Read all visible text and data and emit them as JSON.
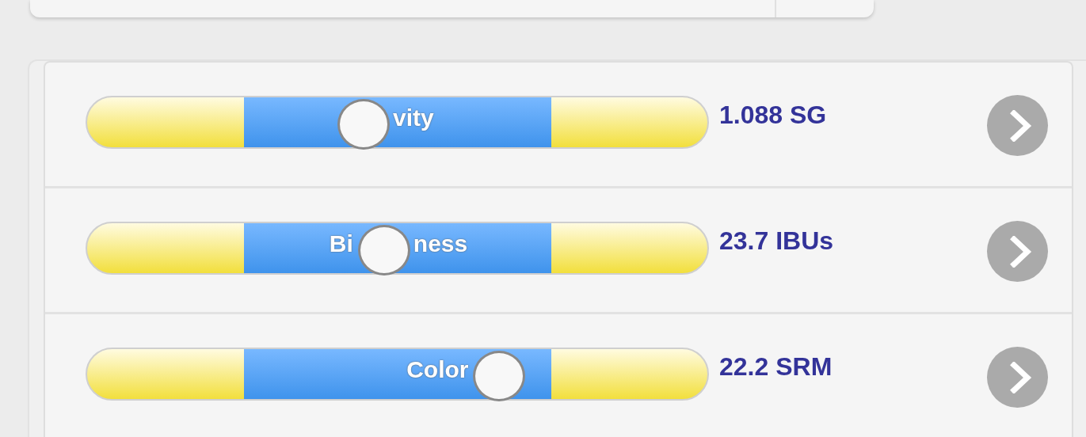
{
  "sliders": [
    {
      "label_after": "vity",
      "level": 0.447,
      "reading": "1.088 SG"
    },
    {
      "label_before": "Bi",
      "label_after": "ness",
      "level": 0.48,
      "reading": "23.7 IBUs"
    },
    {
      "label_before": "Color",
      "level": 0.666,
      "reading": "22.2 SRM"
    }
  ]
}
